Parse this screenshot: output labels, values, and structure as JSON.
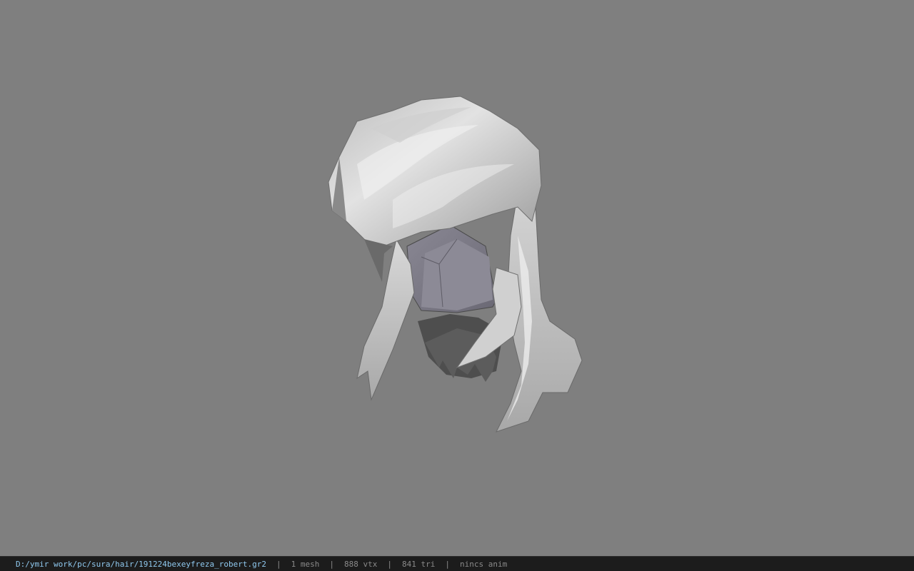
{
  "viewport": {
    "background_color": "#7f7f7f",
    "model": "hair-mesh"
  },
  "status_bar": {
    "file_path": "D:/ymir work/pc/sura/hair/191224bexeyfreza_robert.gr2",
    "separator": "|",
    "mesh_count": "1 mesh",
    "vertex_count": "888 vtx",
    "triangle_count": "841 tri",
    "animation": "nincs anim",
    "path_color": "#8fc8ee",
    "text_color": "#8a8a8a",
    "background_color": "#1c1c1c"
  }
}
